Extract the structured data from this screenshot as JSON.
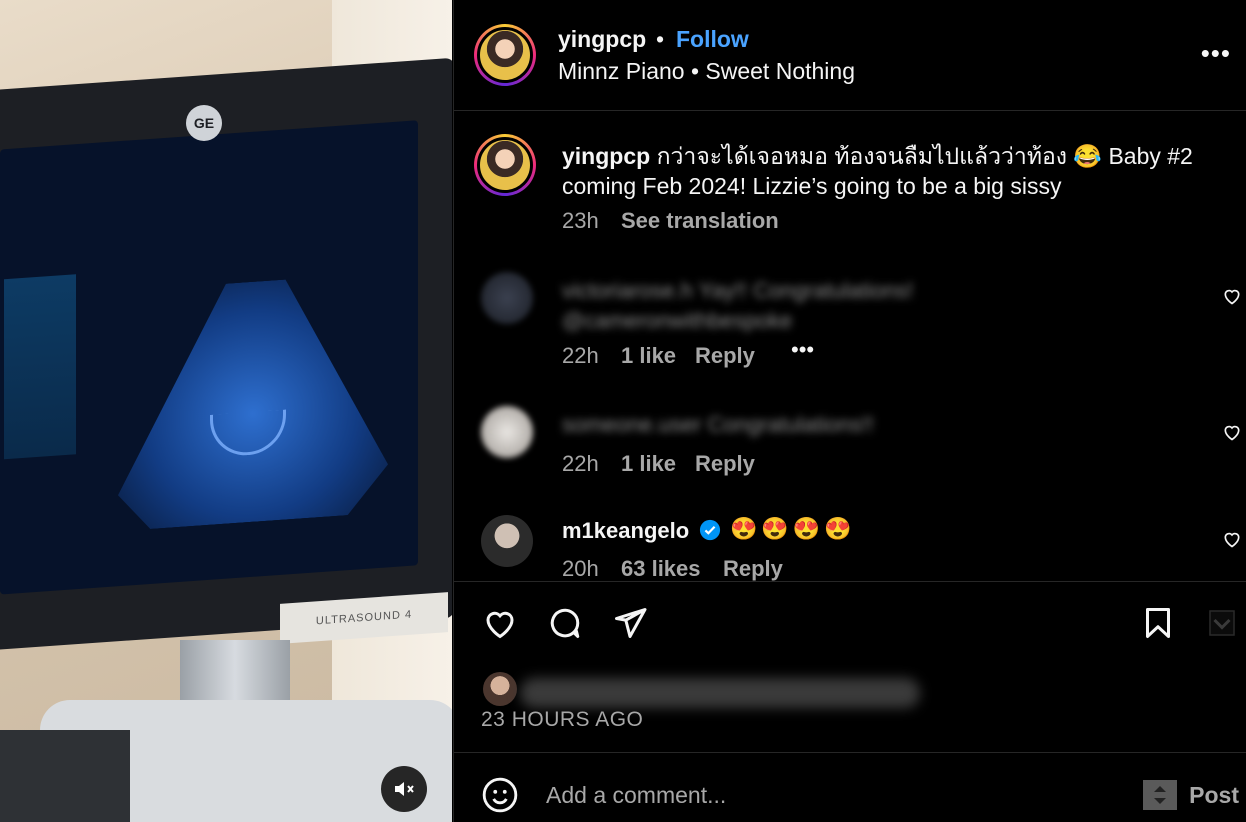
{
  "media": {
    "logo_text": "GE",
    "label_text": "ULTRASOUND 4",
    "mute_icon": "speaker-muted-icon"
  },
  "header": {
    "username": "yingpcp",
    "separator": "•",
    "follow_label": "Follow",
    "music": "Minnz Piano • Sweet Nothing",
    "more_icon": "more-horizontal-icon"
  },
  "caption": {
    "username": "yingpcp",
    "text": "กว่าจะได้เจอหมอ ท้องจนลืมไปแล้วว่าท้อง 😂 Baby #2 coming Feb 2024! Lizzie’s going to be a big sissy",
    "time": "23h",
    "translate_label": "See translation"
  },
  "comments": [
    {
      "blurred_text": "victoriarose.h Yay!! Congratulations! @cameronwithbespoke",
      "time": "22h",
      "likes": "1 like",
      "reply_label": "Reply",
      "more": "•••"
    },
    {
      "blurred_text": "someone.user Congratulations!!",
      "time": "22h",
      "likes": "1 like",
      "reply_label": "Reply"
    },
    {
      "username": "m1keangelo",
      "verified": true,
      "text": "😍😍😍😍",
      "time": "20h",
      "likes": "63 likes",
      "reply_label": "Reply"
    }
  ],
  "actions": {
    "like_icon": "heart-icon",
    "comment_icon": "comment-icon",
    "share_icon": "share-icon",
    "save_icon": "bookmark-icon"
  },
  "footer": {
    "time_ago": "23 HOURS AGO",
    "add_comment_placeholder": "Add a comment...",
    "post_label": "Post",
    "emoji_icon": "emoji-icon"
  },
  "colors": {
    "background": "#000000",
    "accent_blue": "#4aa3ff",
    "muted_text": "#a8a8a8",
    "verified_blue": "#0095f6"
  }
}
